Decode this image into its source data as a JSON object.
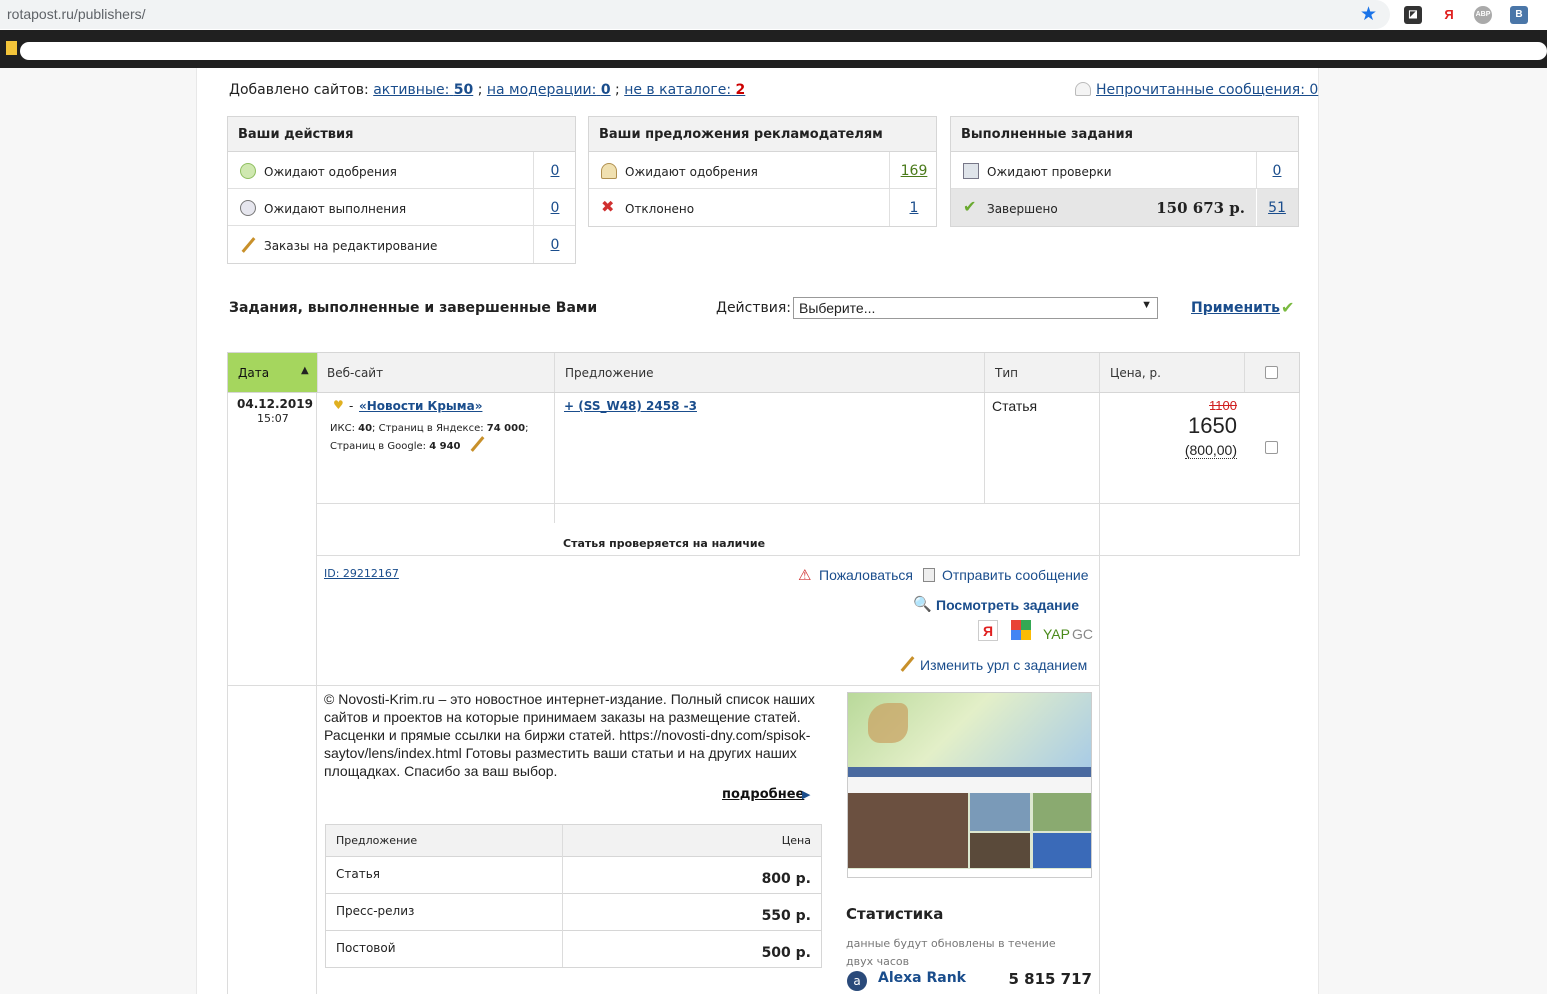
{
  "browser": {
    "url": "rotapost.ru/publishers/",
    "ext": [
      "Я",
      "ABP",
      "B"
    ]
  },
  "summary": {
    "prefix": "Добавлено сайтов:",
    "active_label": "активные:",
    "active_count": "50",
    "sep1": ";",
    "moderation_label": "на модерации:",
    "moderation_count": "0",
    "sep2": ";",
    "notcat_label": "не в каталоге:",
    "notcat_count": "2",
    "unread_label": "Непрочитанные сообщения: 0"
  },
  "actions_box": {
    "title": "Ваши действия",
    "rows": [
      {
        "label": "Ожидают одобрения",
        "count": "0"
      },
      {
        "label": "Ожидают выполнения",
        "count": "0"
      },
      {
        "label": "Заказы на редактирование",
        "count": "0"
      }
    ]
  },
  "offers_box": {
    "title": "Ваши предложения рекламодателям",
    "rows": [
      {
        "label": "Ожидают одобрения",
        "count": "169"
      },
      {
        "label": "Отклонено",
        "count": "1"
      }
    ]
  },
  "done_box": {
    "title": "Выполненные задания",
    "rows": [
      {
        "label": "Ожидают проверки",
        "count": "0"
      },
      {
        "label": "Завершено",
        "amount": "150 673 р.",
        "count": "51"
      }
    ]
  },
  "tasks": {
    "title": "Задания, выполненные и завершенные Вами",
    "actions_label": "Действия:",
    "select_value": "Выберите...",
    "apply_label": "Применить"
  },
  "table": {
    "headers": {
      "date": "Дата",
      "site": "Веб-сайт",
      "offer": "Предложение",
      "type": "Тип",
      "price": "Цена, р."
    }
  },
  "entry": {
    "date": "04.12.2019",
    "time": "15:07",
    "site_prefix": "-",
    "site_name": "«Новости Крыма»",
    "iks_label": "ИКС:",
    "iks": "40",
    "yandex_label": "; Страниц в Яндексе:",
    "yandex": "74 000",
    "yandex_end": ";",
    "google_label": "Страниц в Google:",
    "google": "4 940",
    "offer": "+ (SS_W48) 2458 -3",
    "type": "Статья",
    "old_price": "1100",
    "price": "1650",
    "price_sub": "(800,00)",
    "status": "Статья проверяется на наличие",
    "id": "ID: 29212167",
    "complain": "Пожаловаться",
    "send_msg": "Отправить сообщение",
    "view_task": "Посмотреть задание",
    "yap": "YAP",
    "gc": "GC",
    "ya": "Я",
    "change_url": "Изменить урл с заданием"
  },
  "desc": {
    "text": "© Novosti-Krim.ru – это новостное интернет-издание. Полный список наших сайтов и проектов на которые принимаем заказы на размещение статей. Расценки и прямые ссылки на биржи статей. https://novosti-dny.com/spisok-saytov/lens/index.html Готовы разместить ваши статьи и на других наших площадках. Спасибо за ваш выбор.",
    "more": "подробнее"
  },
  "prices": {
    "h_offer": "Предложение",
    "h_price": "Цена",
    "rows": [
      {
        "name": "Статья",
        "price": "800 р."
      },
      {
        "name": "Пресс-релиз",
        "price": "550 р."
      },
      {
        "name": "Постовой",
        "price": "500 р."
      }
    ]
  },
  "stats": {
    "title": "Статистика",
    "note": "данные будут обновлены в течение двух часов",
    "alexa_label": "Alexa Rank",
    "alexa_value": "5 815 717"
  }
}
